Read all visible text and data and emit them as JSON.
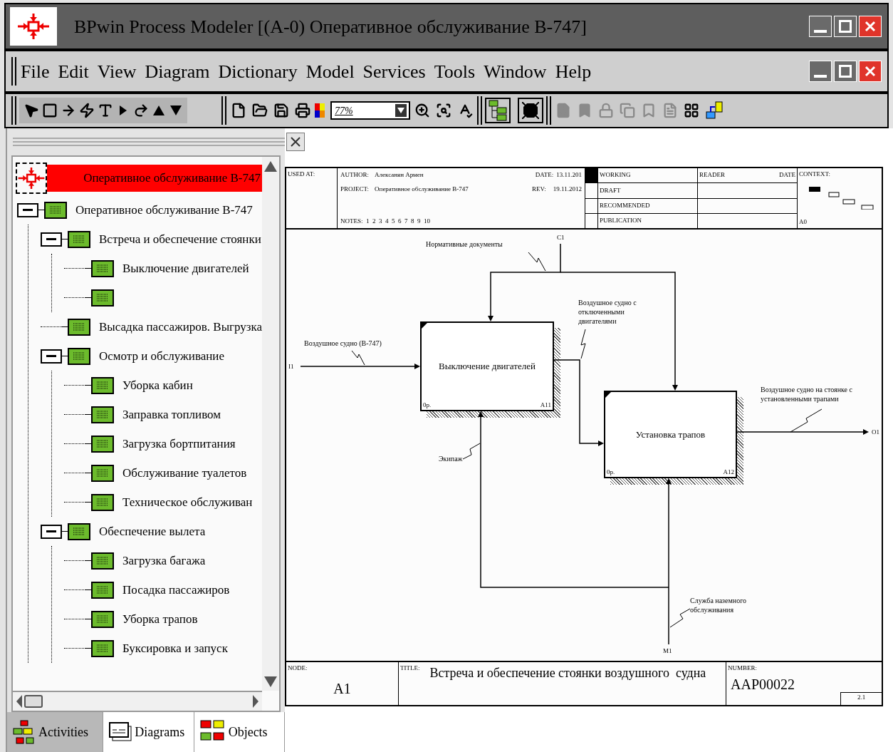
{
  "window": {
    "title": "BPwin Process Modeler [(A-0) Оперативное обслуживание В-747]"
  },
  "menu_bar": [
    {
      "label": "File"
    },
    {
      "label": "Edit"
    },
    {
      "label": "View"
    },
    {
      "label": "Diagram"
    },
    {
      "label": "Dictionary"
    },
    {
      "label": "Model"
    },
    {
      "label": "Services"
    },
    {
      "label": "Tools"
    },
    {
      "label": "Window"
    },
    {
      "label": "Help"
    }
  ],
  "toolbar": {
    "zoom": {
      "value": "77%"
    }
  },
  "model_explorer": {
    "model": {
      "label": "Оперативное обслуживание В-747",
      "selected": true
    },
    "items": [
      {
        "kind": "activity",
        "label": "Оперативное обслуживание В-747",
        "expanded": true,
        "children": [
          {
            "kind": "activity",
            "label": "Встреча и обеспечение стоянки",
            "expanded": true,
            "children": [
              {
                "kind": "activity",
                "label": "Выключение двигателей"
              },
              {
                "kind": "activity"
              }
            ]
          },
          {
            "kind": "activity",
            "label": "Высадка пассажиров. Выгрузка"
          },
          {
            "kind": "activity",
            "label": "Осмотр и обслуживание",
            "expanded": true,
            "children": [
              {
                "kind": "activity",
                "label": "Уборка кабин"
              },
              {
                "kind": "activity",
                "label": "Заправка топливом"
              },
              {
                "kind": "activity",
                "label": "Загрузка бортпитания"
              },
              {
                "kind": "activity",
                "label": "Обслуживание туалетов"
              },
              {
                "kind": "activity",
                "label": "Техническое обслуживан"
              }
            ]
          },
          {
            "kind": "activity",
            "label": "Обеспечение вылета",
            "expanded": true,
            "children": [
              {
                "kind": "activity",
                "label": "Загрузка багажа"
              },
              {
                "kind": "activity",
                "label": "Посадка пассажиров"
              },
              {
                "kind": "activity",
                "label": "Уборка трапов"
              },
              {
                "kind": "activity",
                "label": "Буксировка и запуск"
              }
            ]
          }
        ]
      }
    ]
  },
  "tabs": [
    {
      "label": "Activities",
      "selected": true
    },
    {
      "label": "Diagrams",
      "selected": false
    },
    {
      "label": "Objects",
      "selected": false
    }
  ],
  "diagram": {
    "header": {
      "used_at": "USED AT:",
      "author_label": "AUTHOR:",
      "author": "Алексанян Армен",
      "project_label": "PROJECT:",
      "project": "Оперативное обслуживание В-747",
      "date_label": "DATE:",
      "date": "13.11.201",
      "rev_label": "REV:",
      "rev": "19.11.2012",
      "notes": "NOTES:  1  2  3  4  5  6  7  8  9  10",
      "statuses": [
        {
          "label": "WORKING",
          "selected": true
        },
        {
          "label": "DRAFT",
          "selected": false
        },
        {
          "label": "RECOMMENDED",
          "selected": false
        },
        {
          "label": "PUBLICATION",
          "selected": false
        }
      ],
      "reader": "READER",
      "reader_date": "DATE",
      "context": "CONTEXT:",
      "context_node": "A0"
    },
    "boxes": [
      {
        "label": "Выключение двигателей",
        "cost": "0р.",
        "node": "A11"
      },
      {
        "label": "Установка трапов",
        "cost": "0р.",
        "node": "A12"
      }
    ],
    "arrows": [
      {
        "code": "I1",
        "label": "Воздушное судно (В-747)"
      },
      {
        "code": "C1",
        "label": "Нормативные документы"
      },
      {
        "label": "Воздушное судно с отключенными двигателями"
      },
      {
        "code": "O1",
        "label": "Воздушное судно на стоянке с установленными трапами"
      },
      {
        "label": "Экипаж"
      },
      {
        "code": "M1",
        "label": "Служба наземного обслуживания"
      }
    ],
    "footer": {
      "node_label": "NODE:",
      "node": "A1",
      "title_label": "TITLE:",
      "title": "Встреча и обеспечение стоянки воздушного  судна",
      "number_label": "NUMBER:",
      "number": "AAP00022",
      "page": "2.1"
    }
  }
}
